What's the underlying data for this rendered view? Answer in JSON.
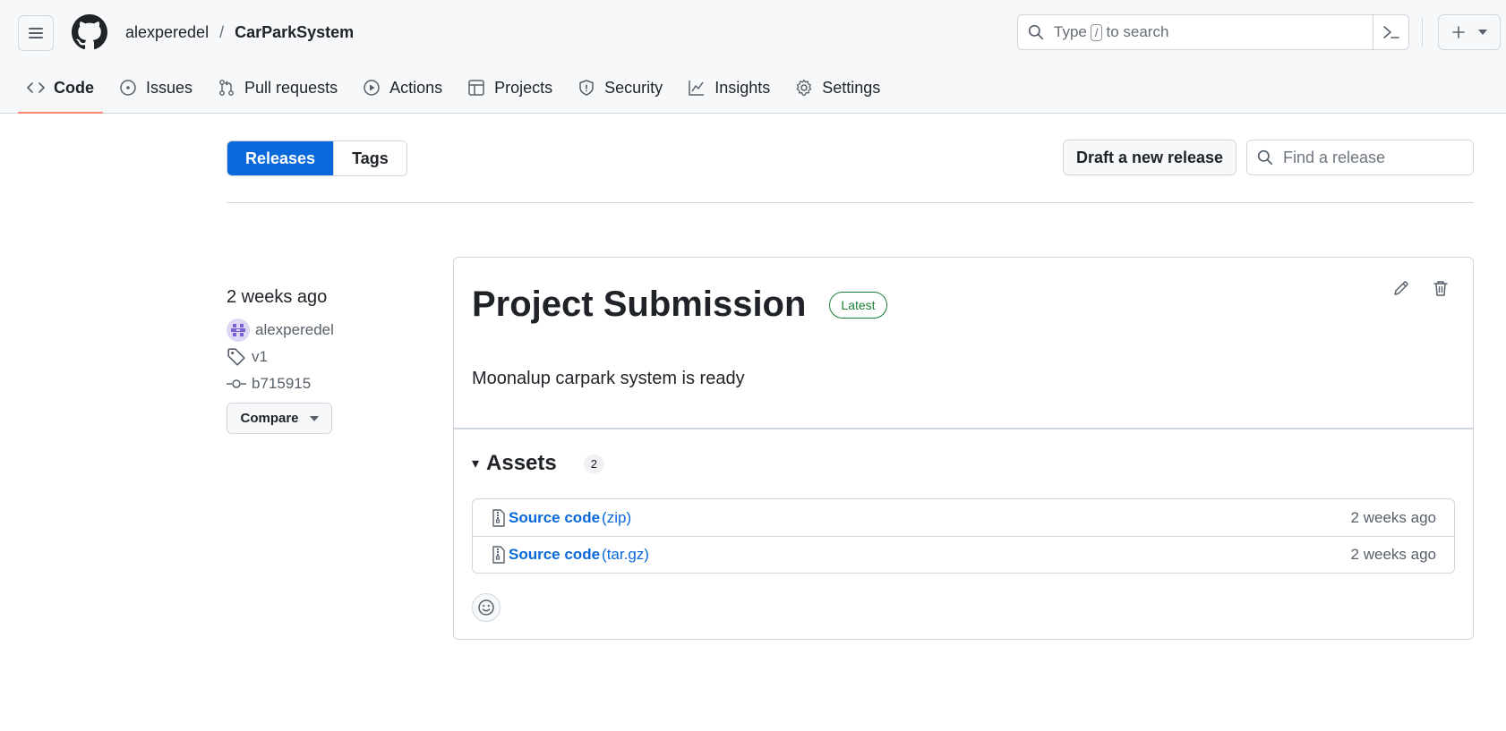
{
  "header": {
    "owner": "alexperedel",
    "separator": "/",
    "repo": "CarParkSystem",
    "search_prefix": "Type",
    "search_key": "/",
    "search_suffix": "to search"
  },
  "tabs": [
    {
      "label": "Code",
      "icon": "code-icon"
    },
    {
      "label": "Issues",
      "icon": "issue-icon"
    },
    {
      "label": "Pull requests",
      "icon": "pull-request-icon"
    },
    {
      "label": "Actions",
      "icon": "play-icon"
    },
    {
      "label": "Projects",
      "icon": "table-icon"
    },
    {
      "label": "Security",
      "icon": "shield-icon"
    },
    {
      "label": "Insights",
      "icon": "graph-icon"
    },
    {
      "label": "Settings",
      "icon": "gear-icon"
    }
  ],
  "subnav": {
    "releases": "Releases",
    "tags": "Tags",
    "draft": "Draft a new release",
    "find_placeholder": "Find a release"
  },
  "meta": {
    "when": "2 weeks ago",
    "author": "alexperedel",
    "tag": "v1",
    "commit": "b715915",
    "compare": "Compare"
  },
  "release": {
    "title": "Project Submission",
    "badge": "Latest",
    "body": "Moonalup carpark system is ready",
    "assets_label": "Assets",
    "assets_count": "2",
    "assets": [
      {
        "name": "Source code",
        "ext": "(zip)",
        "date": "2 weeks ago"
      },
      {
        "name": "Source code",
        "ext": "(tar.gz)",
        "date": "2 weeks ago"
      }
    ]
  },
  "colors": {
    "accent": "#0969da",
    "latest": "#1a7f37",
    "tab_underline": "#fd8c73"
  }
}
